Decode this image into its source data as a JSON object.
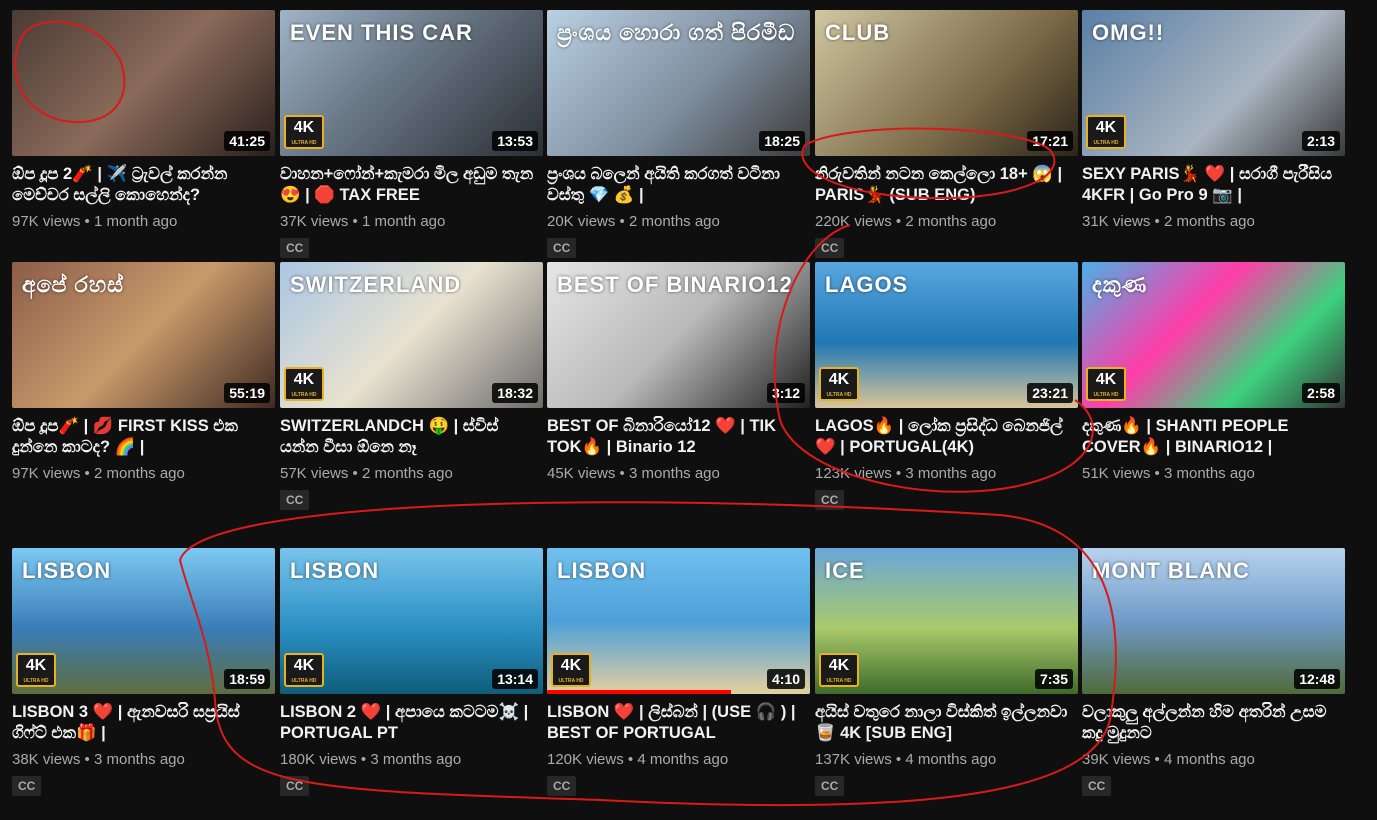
{
  "accent": "#ff0000",
  "annotation_color": "#d91a1a",
  "videos": [
    {
      "title": "ඕප දූප 2🧨 | ✈️ ට්‍රැවල් කරන්න මෙච්චර සල්ලි කොහෙන්ද?",
      "views": "97K views",
      "age": "1 month ago",
      "duration": "41:25",
      "cc": "",
      "four_k": false,
      "overlay": ""
    },
    {
      "title": "වාහන+ෆෝන්+කැමරා මිල අඩුම තැන😍 | 🛑 TAX FREE",
      "views": "37K views",
      "age": "1 month ago",
      "duration": "13:53",
      "cc": "CC",
      "four_k": true,
      "overlay": "EVEN THIS CAR"
    },
    {
      "title": "ප්‍රංශය බලෙන් අයිති කරගත් වටිනා වස්තු 💎 💰 |",
      "views": "20K views",
      "age": "2 months ago",
      "duration": "18:25",
      "cc": "CC",
      "four_k": false,
      "overlay": "ප්‍රංශය හොරා ගත් පිරමීඩ"
    },
    {
      "title": "නිරුවතින් නටන කෙල්ලො 18+ 😱 | PARIS💃 (SUB ENG)",
      "views": "220K views",
      "age": "2 months ago",
      "duration": "17:21",
      "cc": "CC",
      "four_k": false,
      "overlay": "CLUB"
    },
    {
      "title": "SEXY PARIS💃 ❤️ | සරාගී පැරීසිය 4KFR | Go Pro 9 📷 |",
      "views": "31K views",
      "age": "2 months ago",
      "duration": "2:13",
      "cc": "",
      "four_k": true,
      "overlay": "OMG!!"
    },
    {
      "title": "ඕප දූප🧨 | 💋 FIRST KISS එක දුන්නෙ කාටද? 🌈 |",
      "views": "97K views",
      "age": "2 months ago",
      "duration": "55:19",
      "cc": "",
      "four_k": false,
      "overlay": "අපේ රහස්"
    },
    {
      "title": "SWITZERLANDCH 🤑 | ස්විස් යන්න වීසා ඕනෙ නෑ",
      "views": "57K views",
      "age": "2 months ago",
      "duration": "18:32",
      "cc": "CC",
      "four_k": true,
      "overlay": "SWITZERLAND"
    },
    {
      "title": "BEST OF බිනාරියෝ12 ❤️ | TIK TOK🔥 | Binario 12",
      "views": "45K views",
      "age": "3 months ago",
      "duration": "3:12",
      "cc": "",
      "four_k": false,
      "overlay": "BEST OF BINARIO12"
    },
    {
      "title": "LAGOS🔥 | ලෝක ප්‍රසිද්ධ බෙනජිල් ❤️ | PORTUGAL(4K)",
      "views": "123K views",
      "age": "3 months ago",
      "duration": "23:21",
      "cc": "CC",
      "four_k": true,
      "overlay": "LAGOS"
    },
    {
      "title": "දකුණ🔥 | SHANTI PEOPLE COVER🔥 | BINARIO12 |",
      "views": "51K views",
      "age": "3 months ago",
      "duration": "2:58",
      "cc": "",
      "four_k": true,
      "overlay": "දකුණ"
    },
    {
      "title": "LISBON 3 ❤️ | ඇනවසරි සප්‍රයිස් ගිෆ්ට් එක🎁 |",
      "views": "38K views",
      "age": "3 months ago",
      "duration": "18:59",
      "cc": "CC",
      "four_k": true,
      "overlay": "LISBON"
    },
    {
      "title": "LISBON 2 ❤️ | අපායෙ කටටම☠️ | PORTUGAL PT",
      "views": "180K views",
      "age": "3 months ago",
      "duration": "13:14",
      "cc": "CC",
      "four_k": true,
      "overlay": "LISBON"
    },
    {
      "title": "LISBON ❤️ | ලිස්බන් | (USE 🎧 ) | BEST OF PORTUGAL",
      "views": "120K views",
      "age": "4 months ago",
      "duration": "4:10",
      "cc": "CC",
      "four_k": true,
      "overlay": "LISBON",
      "watched": 0.7
    },
    {
      "title": "අයිස් වතුරෙ නාලා විස්කිත් ඉල්ලනවා 🥃 4K [SUB ENG]",
      "views": "137K views",
      "age": "4 months ago",
      "duration": "7:35",
      "cc": "CC",
      "four_k": true,
      "overlay": "ICE"
    },
    {
      "title": "වලාකුලු අල්ලන්න හිම අතරින් උසම කදු මුදුනට",
      "views": "39K views",
      "age": "4 months ago",
      "duration": "12:48",
      "cc": "CC",
      "four_k": false,
      "overlay": "MONT BLANC"
    }
  ]
}
